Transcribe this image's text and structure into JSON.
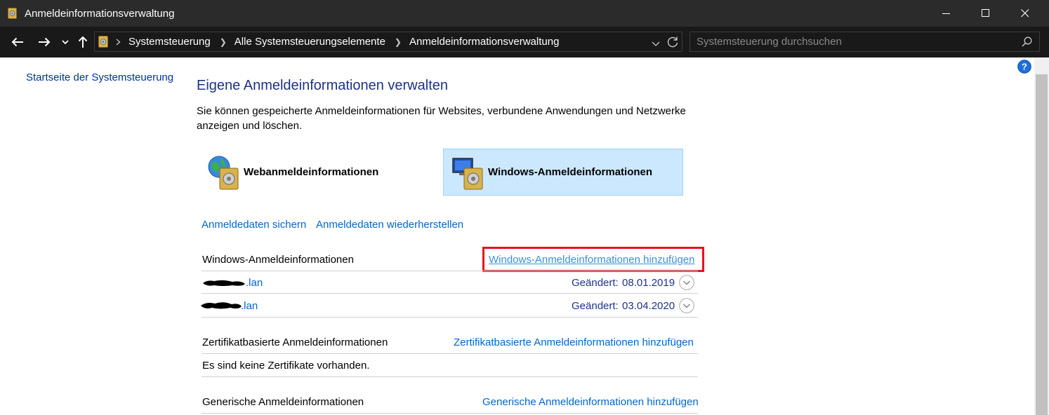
{
  "window": {
    "title": "Anmeldeinformationsverwaltung"
  },
  "breadcrumbs": [
    "Systemsteuerung",
    "Alle Systemsteuerungselemente",
    "Anmeldeinformationsverwaltung"
  ],
  "search": {
    "placeholder": "Systemsteuerung durchsuchen"
  },
  "sidebar": {
    "home_link": "Startseite der Systemsteuerung"
  },
  "main": {
    "heading": "Eigene Anmeldeinformationen verwalten",
    "description": "Sie können gespeicherte Anmeldeinformationen für Websites, verbundene Anwendungen und Netzwerke anzeigen und löschen.",
    "tiles": [
      {
        "label": "Webanmeldeinformationen",
        "selected": false
      },
      {
        "label": "Windows-Anmeldeinformationen",
        "selected": true
      }
    ],
    "backup_link": "Anmeldedaten sichern",
    "restore_link": "Anmeldedaten wiederherstellen",
    "windows_section": {
      "title": "Windows-Anmeldeinformationen",
      "add_link": "Windows-Anmeldeinformationen hinzufügen",
      "entries": [
        {
          "name": ".lan",
          "changed_label": "Geändert:",
          "date": "08.01.2019"
        },
        {
          "name": ".lan",
          "changed_label": "Geändert:",
          "date": "03.04.2020"
        }
      ]
    },
    "certificate_section": {
      "title": "Zertifikatbasierte Anmeldeinformationen",
      "add_link": "Zertifikatbasierte Anmeldeinformationen hinzufügen",
      "empty_text": "Es sind keine Zertifikate vorhanden."
    },
    "generic_section": {
      "title": "Generische Anmeldeinformationen",
      "add_link": "Generische Anmeldeinformationen hinzufügen"
    }
  },
  "colors": {
    "link": "#0066cc",
    "heading": "#1e3287",
    "selected_tile": "#cce8ff",
    "highlight": "#e8111d"
  }
}
